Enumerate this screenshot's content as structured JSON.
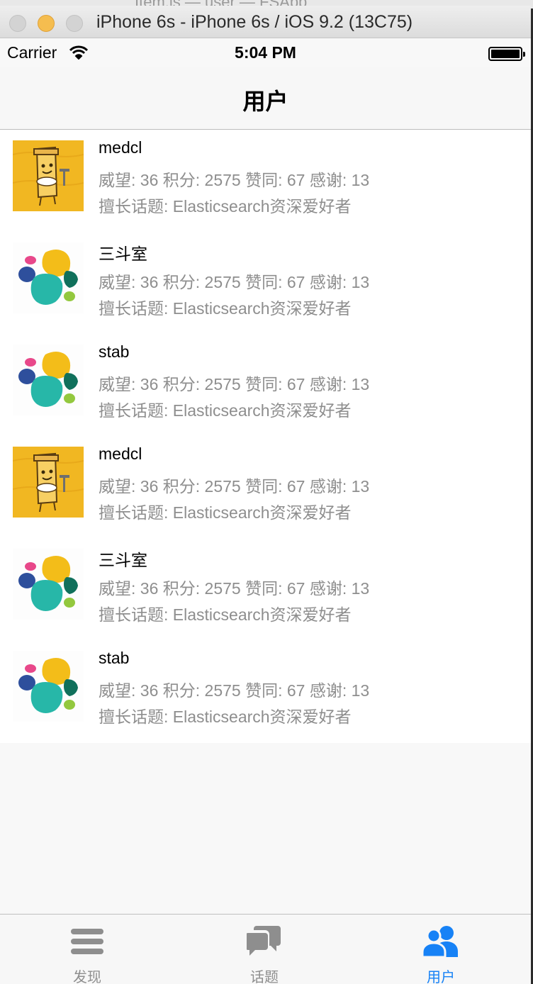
{
  "window": {
    "behind_title": "Item.js — user — FSApp",
    "title": "iPhone 6s - iPhone 6s / iOS 9.2 (13C75)"
  },
  "status_bar": {
    "carrier": "Carrier",
    "time": "5:04 PM"
  },
  "nav": {
    "title": "用户"
  },
  "users": [
    {
      "name": "medcl",
      "stats": "威望: 36 积分: 2575 赞同: 67 感谢: 13",
      "topic": "擅长话题: Elasticsearch资深爱好者",
      "avatar": "cartoon-avatar"
    },
    {
      "name": "三斗室",
      "stats": "威望: 36 积分: 2575 赞同: 67 感谢: 13",
      "topic": "擅长话题: Elasticsearch资深爱好者",
      "avatar": "elastic-logo-avatar"
    },
    {
      "name": "stab",
      "stats": "威望: 36 积分: 2575 赞同: 67 感谢: 13",
      "topic": "擅长话题: Elasticsearch资深爱好者",
      "avatar": "elastic-logo-avatar"
    },
    {
      "name": "medcl",
      "stats": "威望: 36 积分: 2575 赞同: 67 感谢: 13",
      "topic": "擅长话题: Elasticsearch资深爱好者",
      "avatar": "cartoon-avatar"
    },
    {
      "name": "三斗室",
      "stats": "威望: 36 积分: 2575 赞同: 67 感谢: 13",
      "topic": "擅长话题: Elasticsearch资深爱好者",
      "avatar": "elastic-logo-avatar"
    },
    {
      "name": "stab",
      "stats": "威望: 36 积分: 2575 赞同: 67 感谢: 13",
      "topic": "擅长话题: Elasticsearch资深爱好者",
      "avatar": "elastic-logo-avatar"
    }
  ],
  "tabs": [
    {
      "label": "发现",
      "icon": "menu-icon",
      "active": false
    },
    {
      "label": "话题",
      "icon": "chat-bubbles-icon",
      "active": false
    },
    {
      "label": "用户",
      "icon": "users-icon",
      "active": true
    }
  ],
  "colors": {
    "accent": "#1782f6",
    "secondary_text": "#8e8e8e"
  }
}
